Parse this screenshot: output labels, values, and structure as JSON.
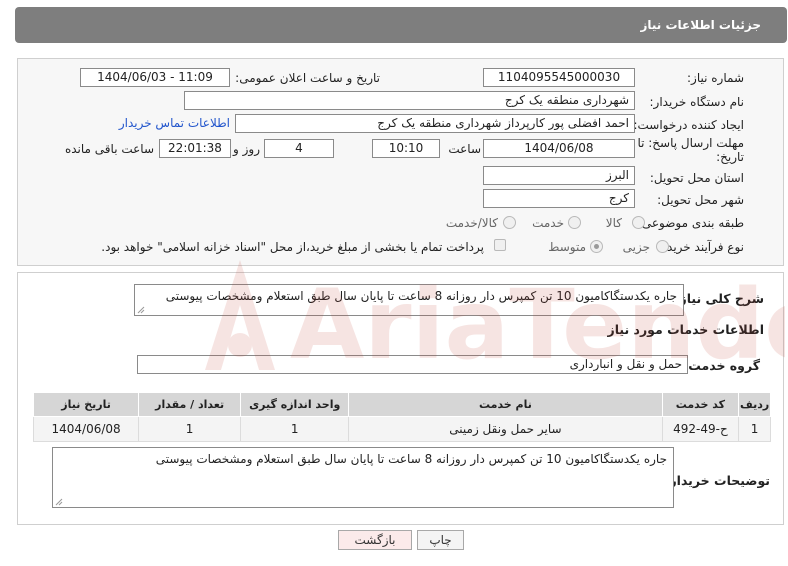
{
  "header": {
    "title": "جزئیات اطلاعات نیاز"
  },
  "need_number": {
    "label": "شماره نیاز:",
    "value": "1104095545000030"
  },
  "announce_datetime": {
    "label": "تاریخ و ساعت اعلان عمومی:",
    "value": "1404/06/03 - 11:09"
  },
  "buyer_org": {
    "label": "نام دستگاه خریدار:",
    "value": "شهرداری منطقه یک کرج"
  },
  "requester": {
    "label": "ایجاد کننده درخواست:",
    "value": "احمد افضلی پور کارپرداز شهرداری منطقه یک کرج",
    "contact_link": "اطلاعات تماس خریدار"
  },
  "deadline": {
    "label_line1": "مهلت ارسال پاسخ: تا",
    "label_line2": "تاریخ:",
    "date": "1404/06/08",
    "time_label": "ساعت",
    "time": "10:10",
    "days": "4",
    "days_label": "روز و",
    "remaining": "22:01:38",
    "remaining_label": "ساعت باقی مانده"
  },
  "delivery_province": {
    "label": "استان محل تحویل:",
    "value": "البرز"
  },
  "delivery_city": {
    "label": "شهر محل تحویل:",
    "value": "کرج"
  },
  "category": {
    "label": "طبقه بندی موضوعی:",
    "options": [
      "کالا",
      "خدمت",
      "کالا/خدمت"
    ]
  },
  "purchase_type": {
    "label": "نوع فرآیند خرید :",
    "options": [
      "جزیی",
      "متوسط"
    ],
    "note": "پرداخت تمام یا بخشی از مبلغ خرید،از محل \"اسناد خزانه اسلامی\" خواهد بود."
  },
  "general_desc": {
    "label": "شرح کلی نیاز:",
    "value": "جاره یکدستگاکامیون  10 تن کمپرس دار روزانه 8 ساعت تا پایان سال  طبق استعلام ومشخصات پیوستی"
  },
  "services_section": {
    "title": "اطلاعات خدمات مورد نیاز"
  },
  "service_group": {
    "label": "گروه خدمت:",
    "value": "حمل و نقل و انبارداری"
  },
  "table": {
    "headers": [
      "ردیف",
      "کد خدمت",
      "نام خدمت",
      "واحد اندازه گیری",
      "تعداد / مقدار",
      "تاریخ نیاز"
    ],
    "rows": [
      [
        "1",
        "ح-49-492",
        "سایر حمل ونقل زمینی",
        "1",
        "1",
        "1404/06/08"
      ]
    ]
  },
  "buyer_notes": {
    "label": "توضیحات خریدار:",
    "value": "جاره یکدستگاکامیون  10 تن کمپرس دار روزانه 8 ساعت تا پایان سال  طبق استعلام ومشخصات پیوستی"
  },
  "buttons": {
    "print": "چاپ",
    "back": "بازگشت"
  },
  "watermark": {
    "text": "AriaTender.net"
  },
  "colors": {
    "header_bg": "#7e7e7e",
    "link": "#2255cc",
    "back_button_bg": "#fbeaea",
    "watermark": "#c0392b"
  }
}
